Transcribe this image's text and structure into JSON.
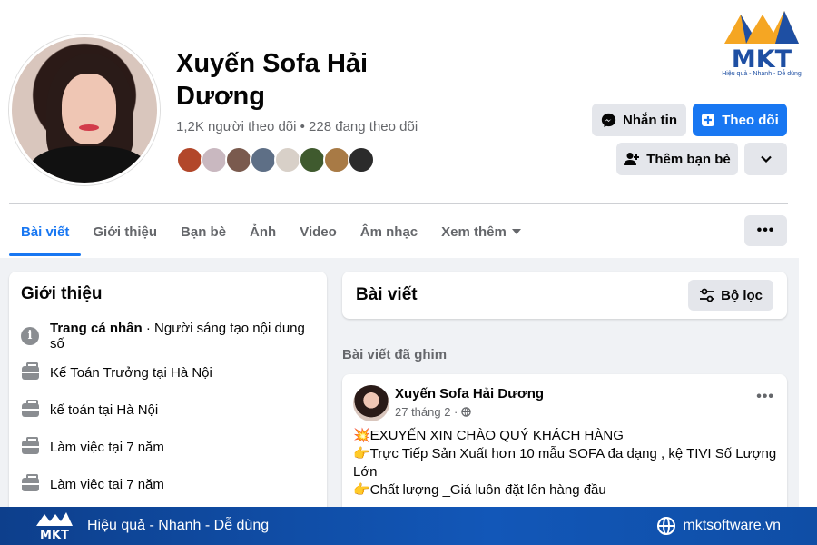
{
  "profile": {
    "name": "Xuyến Sofa Hải Dương",
    "stats": "1,2K người theo dõi • 228 đang theo dõi",
    "friend_avatar_colors": [
      "#b2472a",
      "#c9b8c0",
      "#7a5a4e",
      "#5e6f86",
      "#d8d0c8",
      "#3f5a2e",
      "#a87a45",
      "#2b2b2b"
    ]
  },
  "brand": {
    "logo_text": "MKT",
    "logo_tagline": "Hiệu quả - Nhanh - Dễ dùng",
    "colors": {
      "orange": "#f5a623",
      "blue": "#1e4fa3"
    }
  },
  "actions": {
    "message_label": "Nhắn tin",
    "message_icon": "messenger-icon",
    "follow_label": "Theo dõi",
    "follow_icon": "follow-plus-icon",
    "add_friend_label": "Thêm bạn bè",
    "add_friend_icon": "add-person-icon",
    "dropdown_icon": "chevron-down-icon"
  },
  "tabs": [
    {
      "label": "Bài viết",
      "active": true
    },
    {
      "label": "Giới thiệu"
    },
    {
      "label": "Bạn bè"
    },
    {
      "label": "Ảnh"
    },
    {
      "label": "Video"
    },
    {
      "label": "Âm nhạc"
    },
    {
      "label": "Xem thêm"
    }
  ],
  "more_button": "•••",
  "intro": {
    "title": "Giới thiệu",
    "page_type_bold": "Trang cá nhân",
    "page_type_rest": " · Người sáng tạo nội dung số",
    "items": [
      "Kế Toán Trưởng tại Hà Nội",
      "kế toán tại Hà Nội",
      "Làm việc tại 7 năm",
      "Làm việc tại 7 năm"
    ]
  },
  "posts": {
    "title": "Bài viết",
    "filter_label": "Bộ lọc",
    "pinned_label": "Bài viết đã ghim",
    "post": {
      "author": "Xuyến Sofa Hải Dương",
      "date": "27 tháng 2 · ",
      "lines": [
        "💥EXUYẾN XIN CHÀO QUÝ KHÁCH HÀNG",
        "👉Trực Tiếp Sản Xuất  hơn 10 mẫu SOFA  đa dạng , kệ TIVI Số Lượng Lớn",
        "👉Chất lượng _Giá luôn đặt lên hàng đầu"
      ]
    }
  },
  "footer": {
    "slogan": "Hiệu quả - Nhanh - Dễ dùng",
    "website": "mktsoftware.vn",
    "colors": {
      "bg": "#1257b8"
    }
  }
}
